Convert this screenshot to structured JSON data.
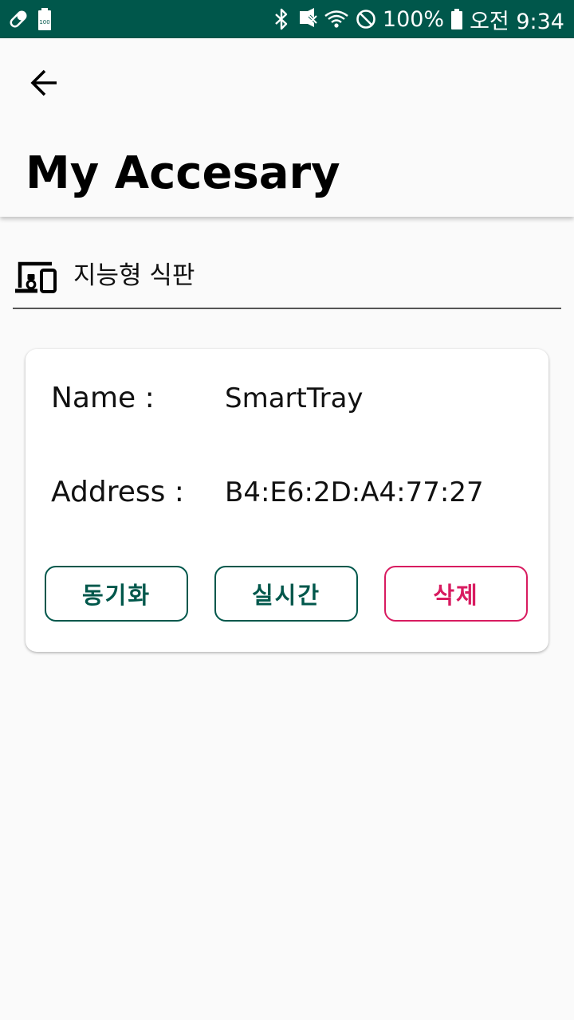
{
  "status_bar": {
    "left_icons": [
      "pill-icon",
      "battery-100-icon"
    ],
    "right_icons": [
      "bluetooth-icon",
      "vibrate-off-icon",
      "wifi-icon",
      "do-not-disturb-icon"
    ],
    "battery_percent": "100%",
    "time": "오전 9:34"
  },
  "header": {
    "title": "My Accesary"
  },
  "section": {
    "icon": "devices-icon",
    "label": "지능형 식판"
  },
  "device": {
    "name_label": "Name :",
    "name_value": "SmartTray",
    "address_label": "Address :",
    "address_value": "B4:E6:2D:A4:77:27"
  },
  "actions": {
    "sync_label": "동기화",
    "realtime_label": "실시간",
    "delete_label": "삭제"
  },
  "colors": {
    "status_bar": "#00574b",
    "primary": "#00574b",
    "danger": "#d81b60",
    "background": "#fafafa"
  }
}
